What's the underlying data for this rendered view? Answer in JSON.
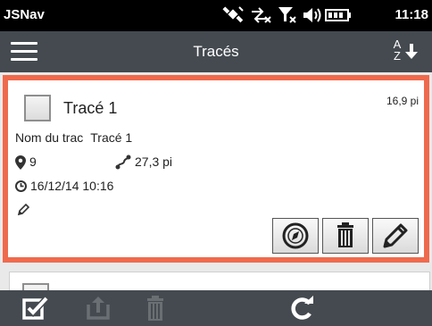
{
  "statusbar": {
    "app_name": "JSNav",
    "time": "11:18",
    "icons": [
      "satellite-icon",
      "data-connection-icon",
      "no-signal-icon",
      "speaker-icon",
      "battery-icon"
    ]
  },
  "titlebar": {
    "title": "Tracés",
    "menu_icon": "hamburger-menu-icon",
    "sort_label": "A Z",
    "sort_icon": "sort-alpha-down-icon"
  },
  "tracks": [
    {
      "name": "Tracé 1",
      "size": "16,9 pi",
      "field_label": "Nom du trac",
      "field_value": "Tracé 1",
      "points": "9",
      "distance": "27,3 pi",
      "date": "16/12/14 10:16",
      "selected": true,
      "actions": [
        "navigate-button",
        "delete-button",
        "edit-button"
      ]
    }
  ],
  "toolbar": {
    "items": [
      "select-all-icon",
      "export-icon",
      "delete-icon",
      "refresh-icon"
    ]
  },
  "colors": {
    "accent": "#ef6a4d",
    "bar": "#444a50",
    "status": "#000000",
    "disabled": "#6a6f74"
  }
}
